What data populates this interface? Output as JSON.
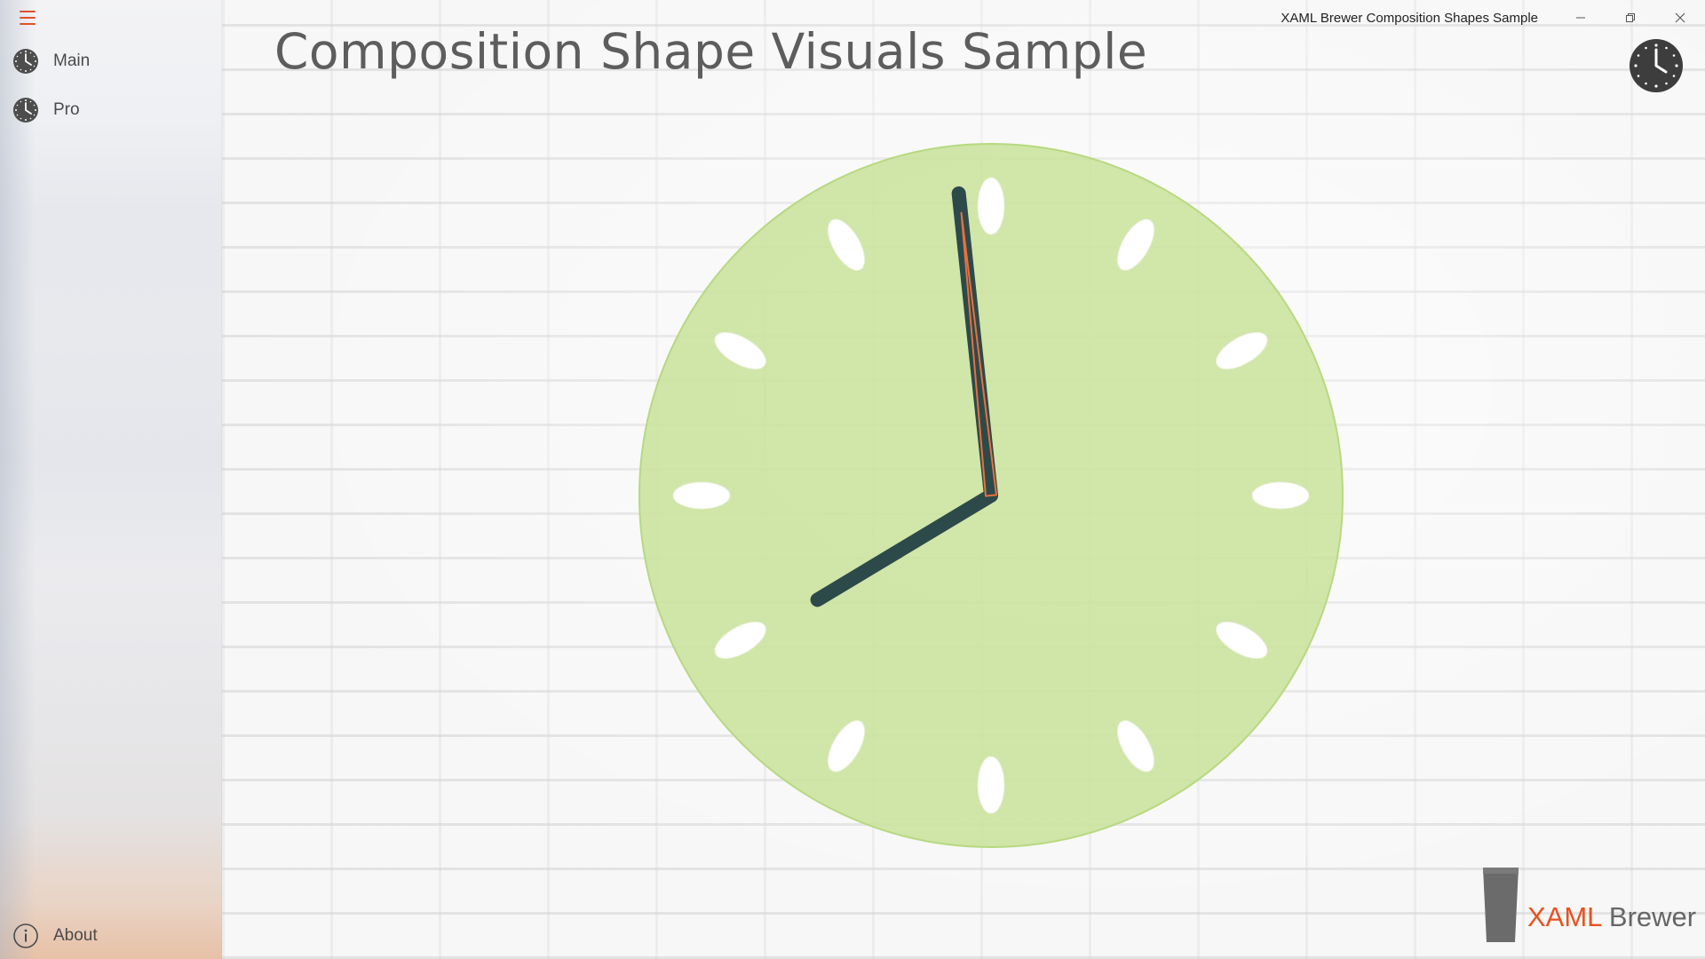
{
  "window": {
    "title": "XAML Brewer Composition Shapes Sample"
  },
  "sidebar": {
    "menu_icon": "hamburger-icon",
    "items": [
      {
        "label": "Main",
        "icon": "clock-icon"
      },
      {
        "label": "Pro",
        "icon": "clock-icon"
      }
    ],
    "footer": {
      "label": "About",
      "icon": "info-icon"
    }
  },
  "main": {
    "title": "Composition Shape Visuals Sample",
    "clock": {
      "face_color": "#c9e29a",
      "hour_hand_color": "#2c4a4a",
      "second_hand_color": "#e8703e",
      "marker_color": "#ffffff",
      "time": {
        "hours": 7,
        "minutes": 58,
        "seconds": 59
      }
    },
    "corner_clock_icon": "analog-clock-icon"
  },
  "brand": {
    "part1": "XAML",
    "part2": "Brewer",
    "icon": "beer-glass-icon",
    "accent_color": "#e8521f"
  }
}
